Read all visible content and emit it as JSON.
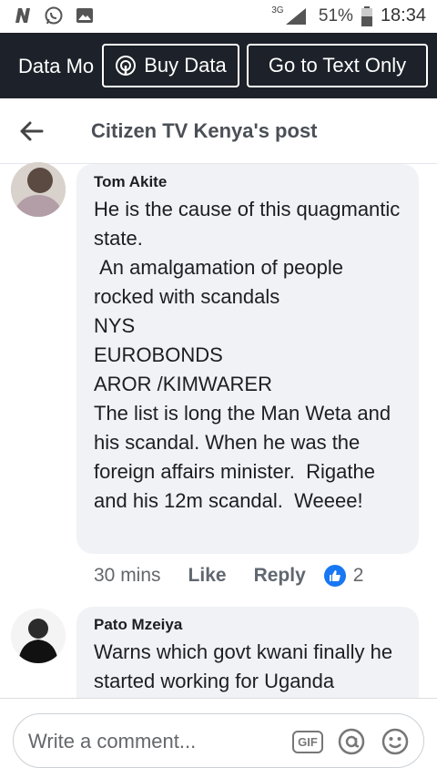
{
  "status_bar": {
    "network": "3G",
    "battery": "51%",
    "time": "18:34",
    "icons": [
      "n-icon",
      "whatsapp-icon",
      "gallery-icon",
      "signal-icon",
      "battery-icon"
    ]
  },
  "data_bar": {
    "mode_label": "Data Mo",
    "buy_data_label": "Buy Data",
    "text_only_label": "Go to Text Only"
  },
  "header": {
    "title": "Citizen TV Kenya's post"
  },
  "comments": [
    {
      "author": "Tom Akite",
      "text": "He is the cause of this quagmantic state.\n An amalgamation of people rocked with scandals\nNYS\nEUROBONDS\nAROR /KIMWARER\nThe list is long the Man Weta and his scandal. When he was the foreign affairs minister.  Rigathe and his 12m scandal.  Weeee!",
      "time": "30 mins",
      "like_label": "Like",
      "reply_label": "Reply",
      "like_count": "2"
    },
    {
      "author": "Pato Mzeiya",
      "text": "Warns which govt kwani finally he started working for Uganda"
    }
  ],
  "composer": {
    "placeholder": "Write a comment...",
    "gif_label": "GIF"
  },
  "colors": {
    "dark_bar": "#1d2129",
    "bubble": "#f0f2f5",
    "like_blue": "#1877f2"
  }
}
